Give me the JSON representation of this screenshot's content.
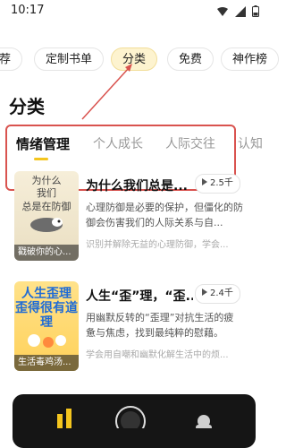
{
  "status": {
    "time": "10:17",
    "icons": [
      "wifi-icon",
      "signal-icon",
      "battery-icon"
    ]
  },
  "chips": [
    {
      "label": "荐"
    },
    {
      "label": "定制书单"
    },
    {
      "label": "分类"
    },
    {
      "label": "免费"
    },
    {
      "label": "神作榜"
    }
  ],
  "page_title": "分类",
  "tabs": [
    {
      "label": "情绪管理"
    },
    {
      "label": "个人成长"
    },
    {
      "label": "人际交往"
    },
    {
      "label": "认知"
    }
  ],
  "items": [
    {
      "cover_title": "为什么\n我们",
      "cover_sub": "总是在防御",
      "cover_caption": "戳破你的心...",
      "title": "为什么我们总是...",
      "plays": "2.5千",
      "desc": "心理防御是必要的保护，但僵化的防御会伤害我们的人际关系与自...",
      "sub": "识别并解除无益的心理防御，学会..."
    },
    {
      "cover_title": "人生歪理\n歪得很有道理",
      "cover_caption": "生活毒鸡汤...",
      "title": "人生“歪”理，“歪...",
      "plays": "2.4千",
      "desc": "用幽默反转的“歪理”对抗生活的疲惫与焦虑，找到最纯粹的慰藉。",
      "sub": "学会用自嘲和幽默化解生活中的烦..."
    }
  ],
  "colors": {
    "accent": "#f4c51e",
    "highlight": "#d9534f",
    "active_chip": "#fdf3cf"
  }
}
